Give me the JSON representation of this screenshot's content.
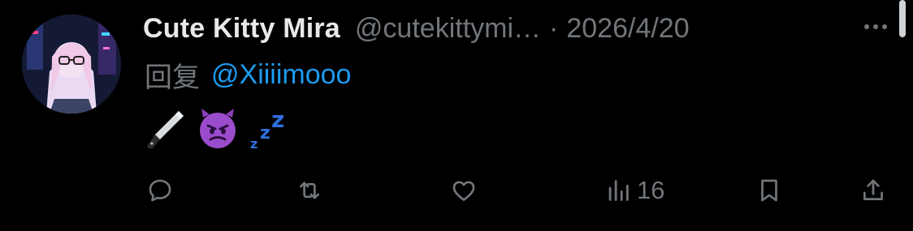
{
  "author": {
    "display_name": "Cute Kitty Mira",
    "handle": "@cutekittymi…",
    "separator": "·",
    "date": "2026/4/20"
  },
  "reply": {
    "prefix": "回复",
    "mention": "@Xiiiimooo"
  },
  "content": {
    "emojis": [
      "kitchen-knife-emoji",
      "smiling-imp-emoji",
      "zzz-emoji"
    ]
  },
  "actions": {
    "views_count": "16"
  },
  "icons": {
    "more": "more-horizontal-icon",
    "reply": "reply-bubble-icon",
    "retweet": "retweet-icon",
    "like": "heart-icon",
    "views": "views-chart-icon",
    "bookmark": "bookmark-icon",
    "share": "share-icon"
  },
  "colors": {
    "background": "#000000",
    "primary_text": "#e7e9ea",
    "secondary_text": "#71767b",
    "link": "#1d9bf0"
  }
}
